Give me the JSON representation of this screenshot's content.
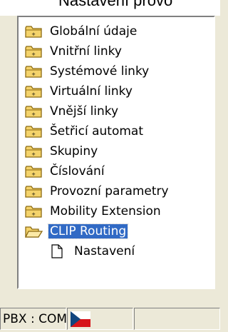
{
  "window": {
    "title_partial": "Nastavení provo"
  },
  "tree": {
    "folders": [
      {
        "label": "Globální údaje"
      },
      {
        "label": "Vnitřní linky"
      },
      {
        "label": "Systémové linky"
      },
      {
        "label": "Virtuální linky"
      },
      {
        "label": "Vnější linky"
      },
      {
        "label": "Šetřicí automat"
      },
      {
        "label": "Skupiny"
      },
      {
        "label": "Číslování"
      },
      {
        "label": "Provozní parametry"
      },
      {
        "label": "Mobility Extension"
      },
      {
        "label": "CLIP Routing",
        "state": "open",
        "selected": true
      }
    ],
    "child": {
      "label": "Nastavení"
    }
  },
  "status_bar": {
    "connection": "PBX : COM",
    "language_flag": "czech-flag"
  },
  "colors": {
    "selection": "#316ac5",
    "folder_fill": "#f4d36b",
    "folder_edge": "#8b6a12"
  }
}
